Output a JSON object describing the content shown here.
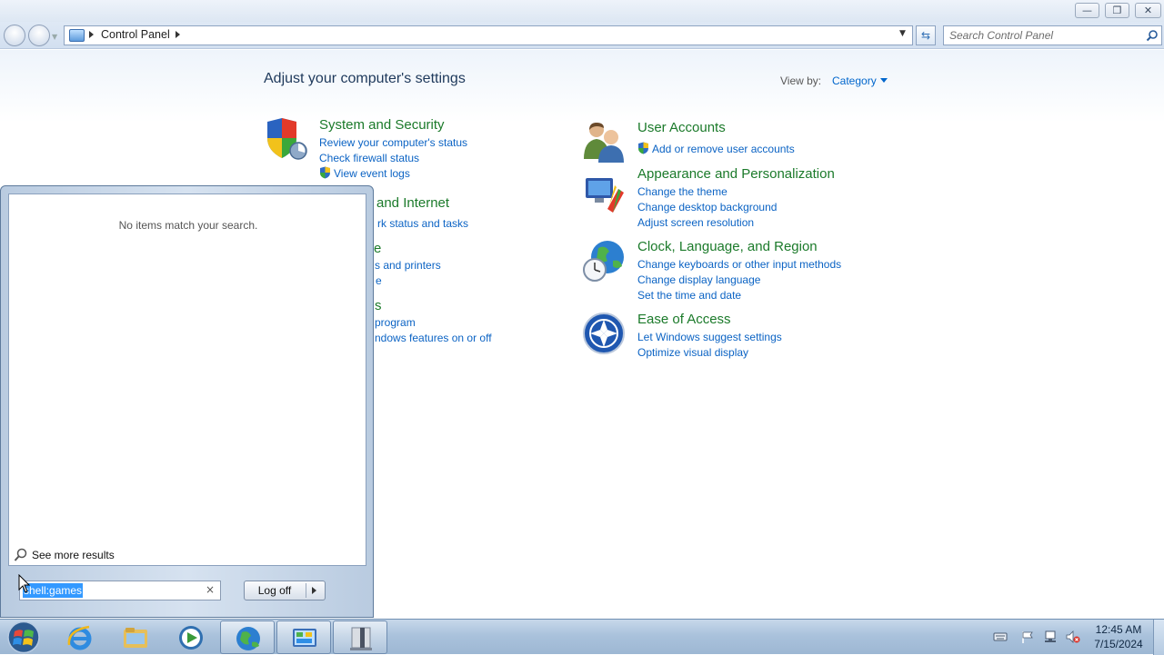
{
  "window": {
    "minimize_glyph": "—",
    "maximize_glyph": "❐",
    "close_glyph": "✕"
  },
  "address_bar": {
    "breadcrumb": "Control Panel",
    "search_placeholder": "Search Control Panel"
  },
  "main": {
    "title": "Adjust your computer's settings",
    "view_by_label": "View by:",
    "view_by_value": "Category"
  },
  "categories_left": [
    {
      "title": "System and Security",
      "links": [
        "Review your computer's status",
        "Check firewall status",
        "View event logs"
      ]
    },
    {
      "title_partial": "and Internet",
      "links_partial": [
        "rk status and tasks"
      ]
    },
    {
      "title_partial": "e",
      "links_partial": [
        "s and printers",
        "e"
      ]
    },
    {
      "title_partial": "s",
      "links_partial": [
        "program",
        "ndows features on or off"
      ]
    }
  ],
  "categories_right": [
    {
      "title": "User Accounts",
      "links": [
        "Add or remove user accounts"
      ]
    },
    {
      "title": "Appearance and Personalization",
      "links": [
        "Change the theme",
        "Change desktop background",
        "Adjust screen resolution"
      ]
    },
    {
      "title": "Clock, Language, and Region",
      "links": [
        "Change keyboards or other input methods",
        "Change display language",
        "Set the time and date"
      ]
    },
    {
      "title": "Ease of Access",
      "links": [
        "Let Windows suggest settings",
        "Optimize visual display"
      ]
    }
  ],
  "start_menu": {
    "no_results": "No items match your search.",
    "see_more": "See more results",
    "search_text": "shell:games",
    "clear_glyph": "×",
    "logoff_label": "Log off"
  },
  "taskbar": {
    "pinned": [
      "internet-explorer",
      "windows-explorer",
      "media-player",
      "network-globe",
      "control-panel",
      "wrench-tool"
    ],
    "time": "12:45 AM",
    "date": "7/15/2024"
  },
  "colors": {
    "category_title": "#1b7a2a",
    "link": "#0b63c4",
    "page_title": "#1e395b"
  }
}
